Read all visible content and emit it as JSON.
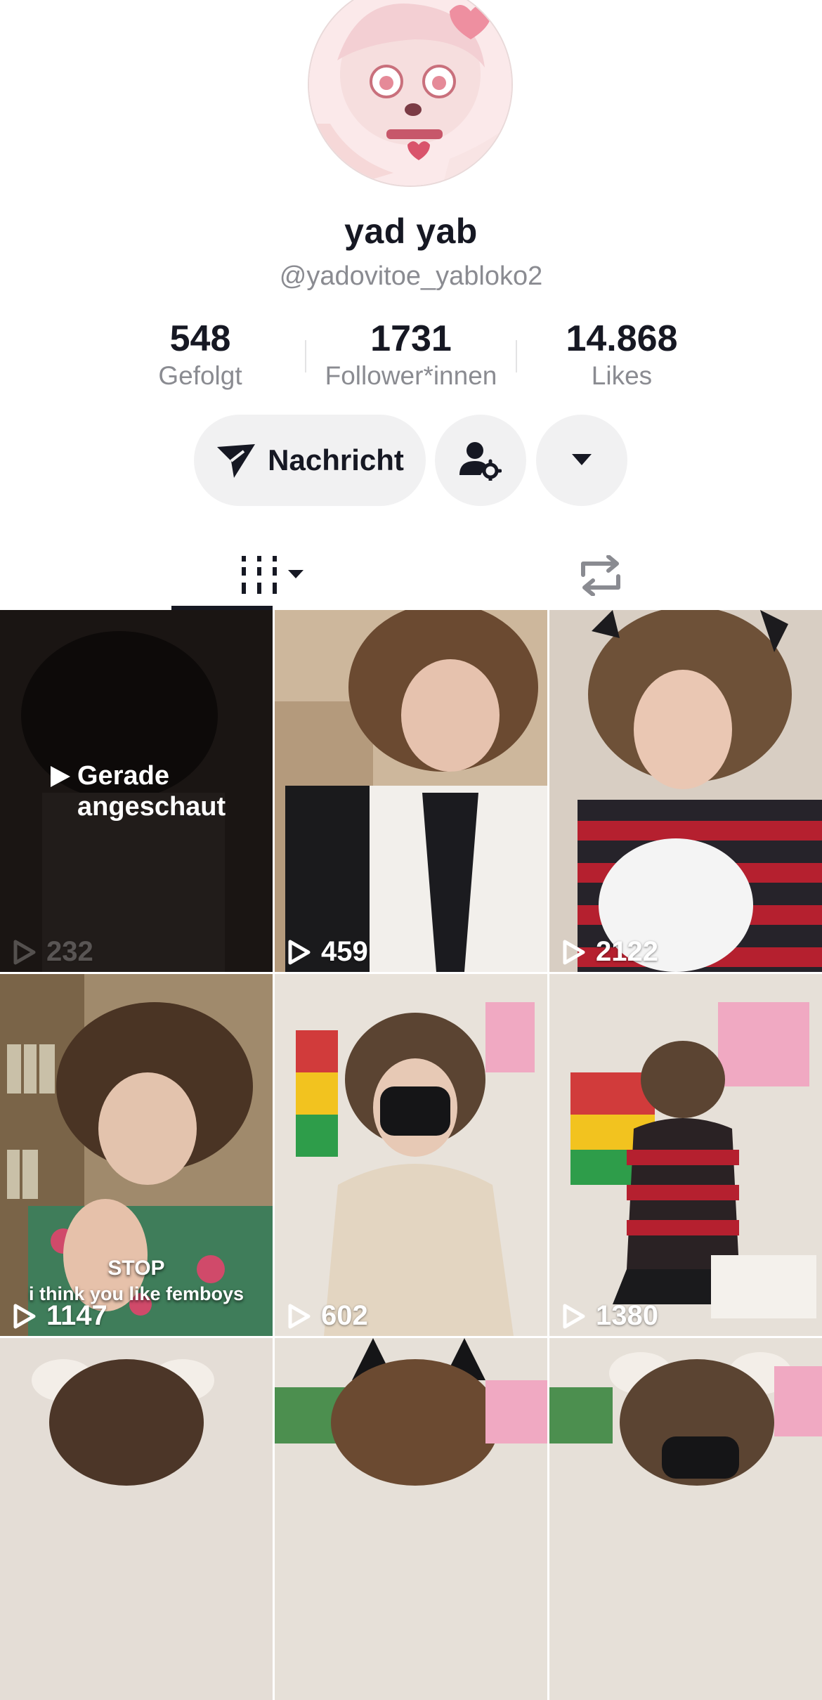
{
  "profile": {
    "display_name": "yad yab",
    "handle": "@yadovitoe_yabloko2"
  },
  "stats": [
    {
      "value": "548",
      "label": "Gefolgt"
    },
    {
      "value": "1731",
      "label": "Follower*innen"
    },
    {
      "value": "14.868",
      "label": "Likes"
    }
  ],
  "actions": {
    "message_label": "Nachricht"
  },
  "tabs": {
    "active": "videos"
  },
  "videos": [
    {
      "views": "232",
      "watched_label_1": "Gerade",
      "watched_label_2": "angeschaut",
      "tone": "#2b2522"
    },
    {
      "views": "459",
      "tone": "#b8a48c"
    },
    {
      "views": "2122",
      "tone": "#c9b9a8"
    },
    {
      "views": "1147",
      "caption_1": "STOP",
      "caption_2": "i think you like femboys",
      "tone": "#8c7a5e"
    },
    {
      "views": "602",
      "tone": "#d7cec3"
    },
    {
      "views": "1380",
      "tone": "#cfc6bd"
    },
    {
      "tone": "#d9d2cc"
    },
    {
      "tone": "#c7bcb2"
    },
    {
      "tone": "#d6ccc4"
    }
  ]
}
